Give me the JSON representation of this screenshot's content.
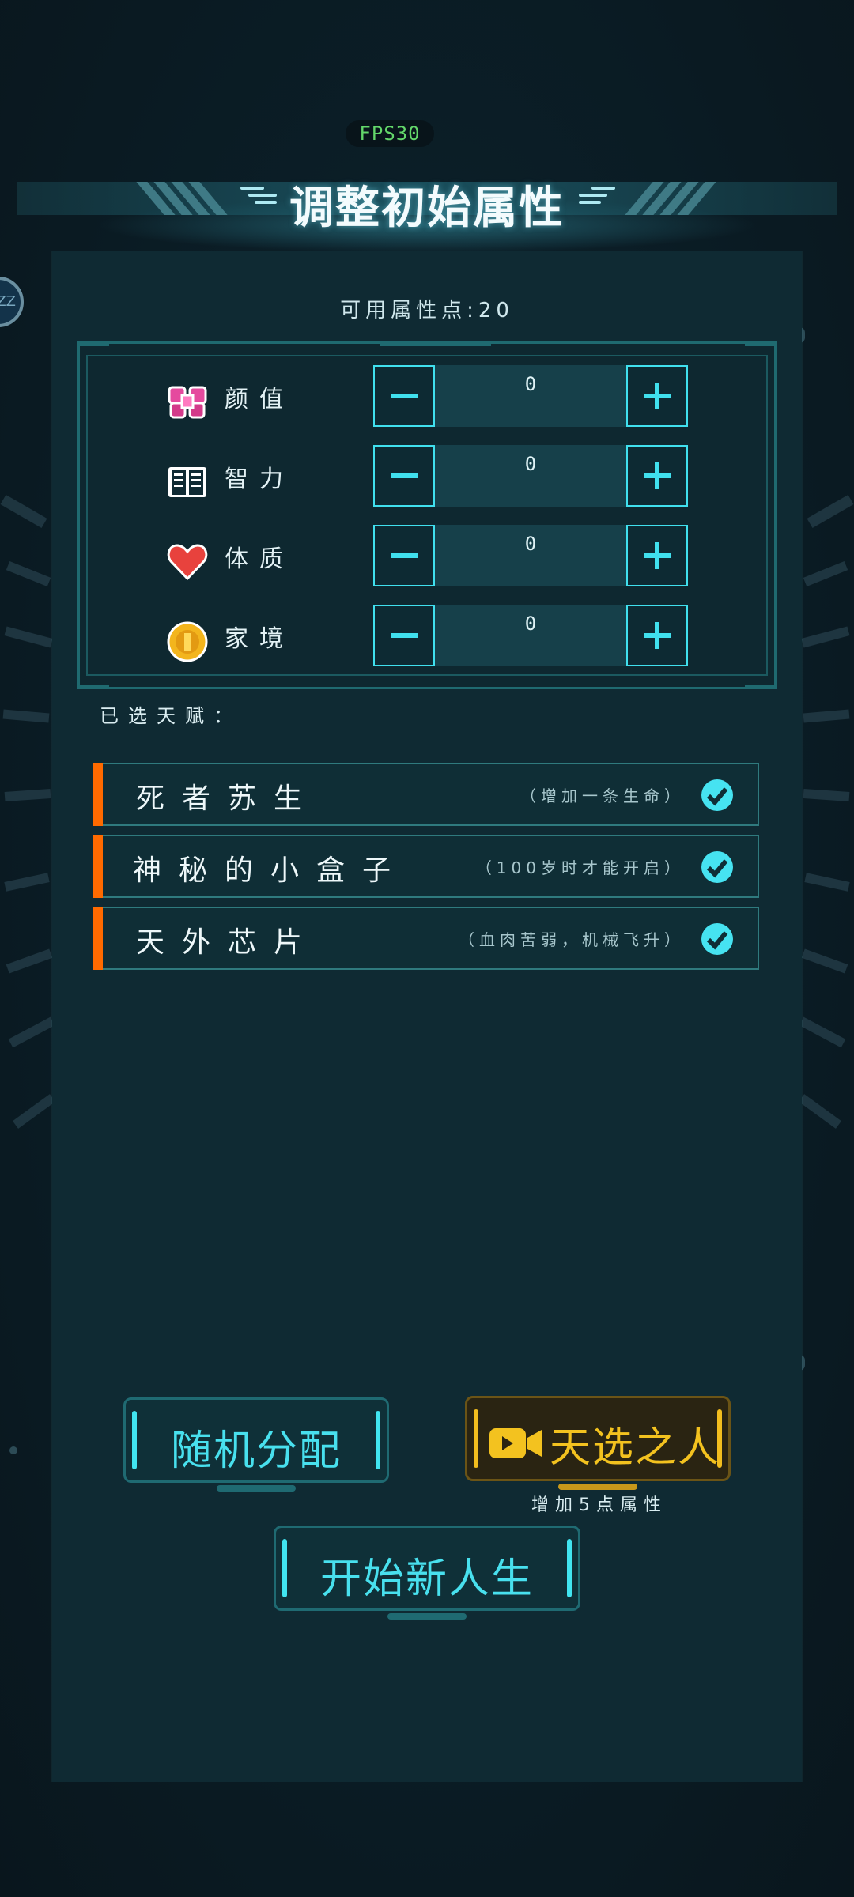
{
  "status": {
    "fps": "FPS30"
  },
  "header": {
    "title": "调整初始属性"
  },
  "side_avatar": {
    "text": "ZZ"
  },
  "attributes": {
    "available_label": "可用属性点:20",
    "items": [
      {
        "icon": "bow-icon",
        "label": "颜值",
        "value": "0"
      },
      {
        "icon": "book-icon",
        "label": "智力",
        "value": "0"
      },
      {
        "icon": "heart-icon",
        "label": "体质",
        "value": "0"
      },
      {
        "icon": "coin-icon",
        "label": "家境",
        "value": "0"
      }
    ]
  },
  "talents": {
    "heading": "已选天赋：",
    "items": [
      {
        "name": "死者苏生",
        "desc": "（增加一条生命）"
      },
      {
        "name": "神秘的小盒子",
        "desc": "（100岁时才能开启）"
      },
      {
        "name": "天外芯片",
        "desc": "（血肉苦弱，机械飞升）"
      }
    ]
  },
  "actions": {
    "random_label": "随机分配",
    "chosen_label": "天选之人",
    "chosen_sub": "增加5点属性",
    "start_label": "开始新人生"
  },
  "colors": {
    "accent": "#40e0ee",
    "gold": "#f3c21f",
    "talent_bar": "#ff6a00",
    "fps_text": "#63d66a"
  }
}
